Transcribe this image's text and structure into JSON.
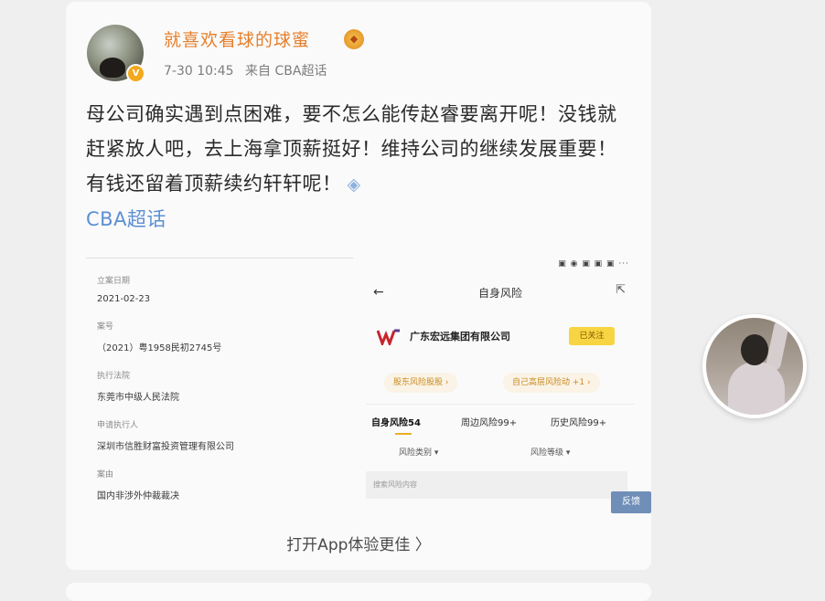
{
  "post": {
    "username": "就喜欢看球的球蜜",
    "time": "7-30 10:45",
    "source": "来自 CBA超话",
    "text": "母公司确实遇到点困难，要不怎么能传赵睿要离开呢！没钱就赶紧放人吧，去上海拿顶薪挺好！维持公司的继续发展重要！有钱还留着顶薪续约轩轩呢！",
    "topic": "CBA超话",
    "open_app": "打开App体验更佳 〉"
  },
  "embedded": {
    "doc_fields": [
      {
        "label": "立案日期",
        "value": "2021-02-23"
      },
      {
        "label": "案号",
        "value": "（2021）粤1958民初2745号"
      },
      {
        "label": "执行法院",
        "value": "东莞市中级人民法院"
      },
      {
        "label": "申请执行人",
        "value": "深圳市信胜财富投资管理有限公司"
      },
      {
        "label": "案由",
        "value": "国内非涉外仲裁裁决"
      }
    ],
    "app": {
      "title": "自身风险",
      "company": "广东宏远集团有限公司",
      "follow": "已关注",
      "chip_left": "股东风险股股 ›",
      "chip_right": "自己高层风险动 +1 ›",
      "tabs": [
        "自身风险54",
        "周边风险99+",
        "历史风险99+"
      ],
      "filters": [
        "风险类别 ▾",
        "风险等级 ▾"
      ],
      "search_placeholder": "搜索风险内容",
      "float_button": "反馈"
    }
  },
  "icons": {
    "verified": "verified-badge-icon",
    "gold": "gold-badge-icon",
    "diamond": "diamond-icon"
  }
}
